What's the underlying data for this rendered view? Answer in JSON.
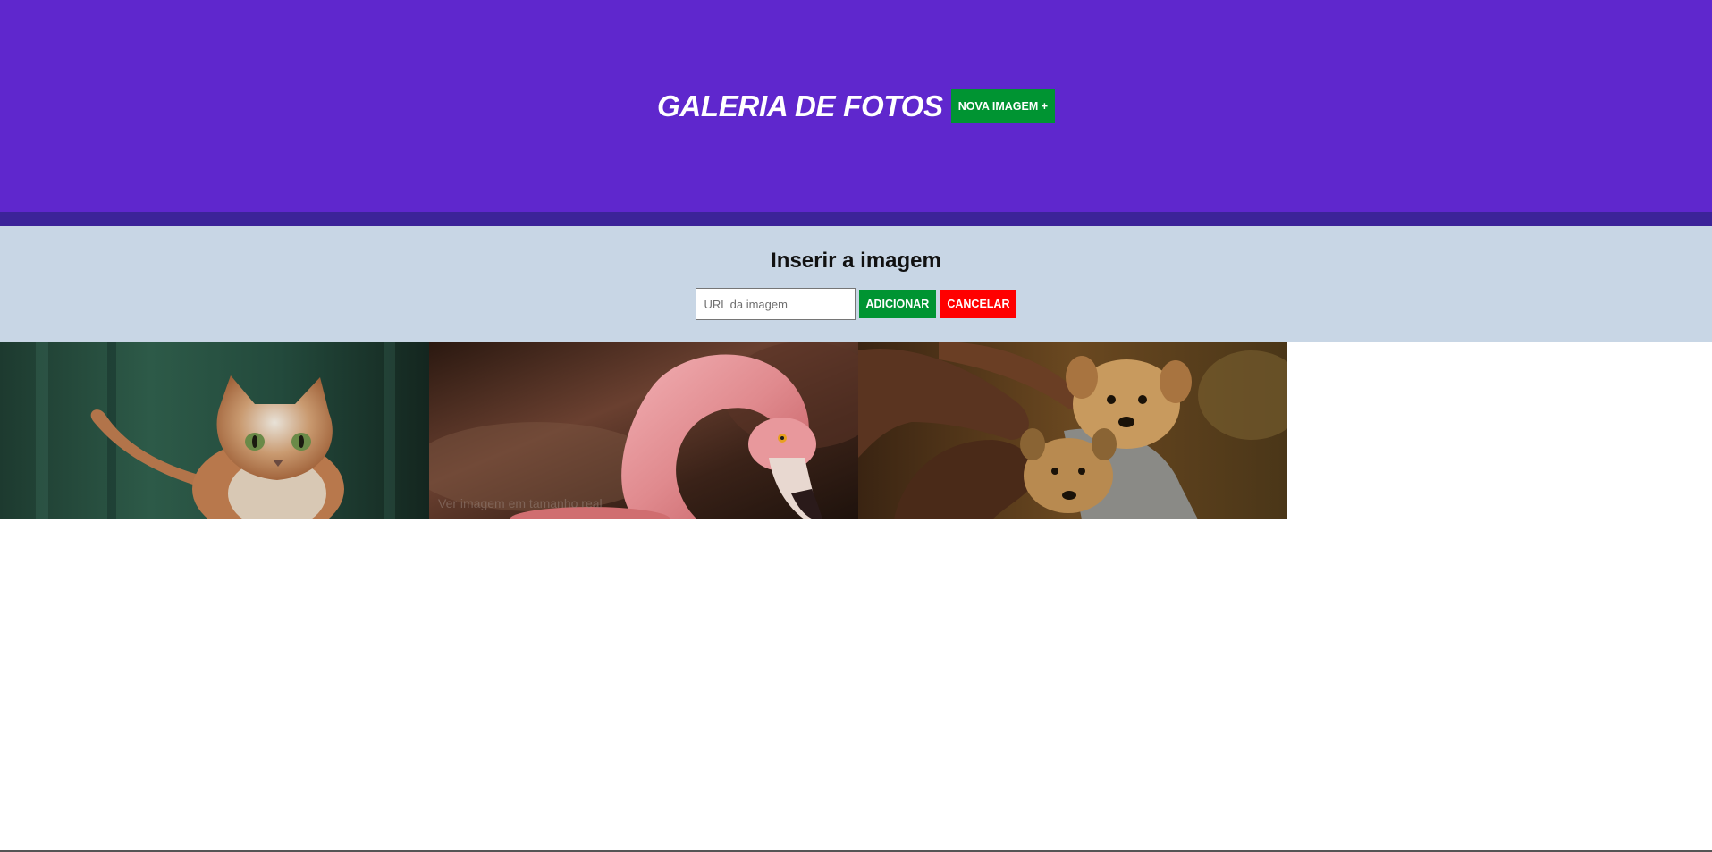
{
  "header": {
    "title": "GALERIA DE FOTOS",
    "new_image_button": "NOVA IMAGEM +"
  },
  "insert_panel": {
    "title": "Inserir a imagem",
    "url_input": {
      "placeholder": "URL da imagem",
      "value": ""
    },
    "add_button": "ADICIONAR",
    "cancel_button": "CANCELAR"
  },
  "gallery": {
    "items": [
      {
        "subject": "cat",
        "overlay_text": ""
      },
      {
        "subject": "flamingo",
        "overlay_text": "Ver imagem em tamanho real"
      },
      {
        "subject": "puppies",
        "overlay_text": ""
      }
    ]
  },
  "colors": {
    "header_bg": "#5f27cd",
    "header_bar": "#3c2399",
    "panel_bg": "#c8d6e5",
    "green_button": "#009432",
    "red_button": "#ff0000"
  }
}
